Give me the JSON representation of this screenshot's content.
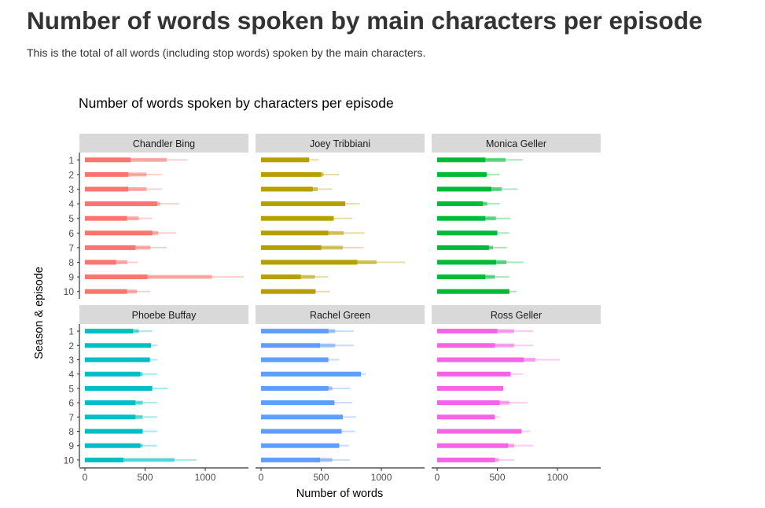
{
  "page": {
    "title": "Number of words spoken by main characters per episode",
    "subtitle": "This is the total of all words (including stop words) spoken by the main characters."
  },
  "colors": {
    "Chandler Bing": "#F8766D",
    "Joey Tribbiani": "#B79F00",
    "Monica Geller": "#00BA38",
    "Phoebe Buffay": "#00BFC4",
    "Rachel Green": "#619CFF",
    "Ross Geller": "#F564E3",
    "strip_background": "#D9D9D9",
    "axis": "#333333"
  },
  "chart_data": {
    "type": "bar",
    "orientation": "horizontal",
    "faceted": true,
    "title": "Number of words spoken by characters per episode",
    "xlabel": "Number of words",
    "ylabel": "Season & episode",
    "xlim": [
      0,
      1350
    ],
    "x_ticks": [
      0,
      500,
      1000
    ],
    "categories": [
      "1",
      "2",
      "3",
      "4",
      "5",
      "6",
      "7",
      "8",
      "9",
      "10"
    ],
    "legend": "none",
    "grid": false,
    "series": [
      {
        "name": "Chandler Bing",
        "values": [
          850,
          640,
          640,
          780,
          560,
          760,
          680,
          440,
          1320,
          540
        ],
        "dense": [
          380,
          360,
          360,
          600,
          350,
          560,
          420,
          260,
          520,
          350
        ]
      },
      {
        "name": "Joey Tribbiani",
        "values": [
          480,
          650,
          590,
          820,
          760,
          860,
          850,
          1200,
          560,
          570
        ],
        "dense": [
          400,
          500,
          430,
          700,
          600,
          560,
          500,
          800,
          330,
          450
        ]
      },
      {
        "name": "Monica Geller",
        "values": [
          710,
          520,
          670,
          520,
          610,
          600,
          580,
          720,
          600,
          660
        ],
        "dense": [
          400,
          410,
          450,
          380,
          400,
          500,
          430,
          490,
          400,
          600
        ]
      },
      {
        "name": "Phoebe Buffay",
        "values": [
          560,
          600,
          600,
          600,
          690,
          600,
          600,
          600,
          600,
          930
        ],
        "dense": [
          400,
          550,
          540,
          460,
          560,
          420,
          420,
          480,
          460,
          320
        ]
      },
      {
        "name": "Rachel Green",
        "values": [
          770,
          770,
          650,
          870,
          740,
          760,
          790,
          780,
          730,
          740
        ],
        "dense": [
          560,
          490,
          560,
          830,
          560,
          610,
          680,
          670,
          650,
          490
        ]
      },
      {
        "name": "Ross Geller",
        "values": [
          800,
          800,
          1020,
          710,
          550,
          750,
          520,
          770,
          800,
          640
        ],
        "dense": [
          500,
          480,
          720,
          610,
          550,
          520,
          480,
          700,
          590,
          480
        ]
      }
    ]
  }
}
